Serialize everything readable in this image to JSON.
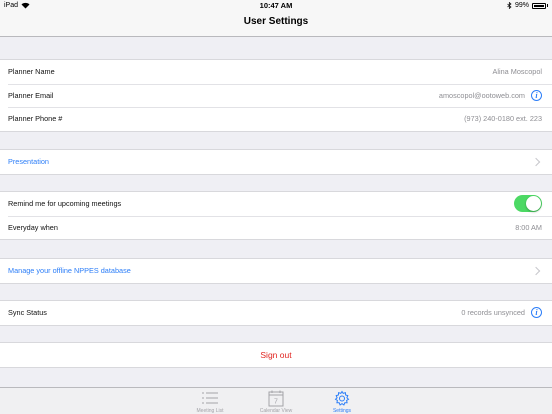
{
  "status_bar": {
    "device": "iPad",
    "time": "10:47 AM",
    "battery": "99%"
  },
  "nav": {
    "title": "User Settings"
  },
  "planner": {
    "name_label": "Planner Name",
    "name_value": "Alina Moscopol",
    "email_label": "Planner Email",
    "email_value": "amoscopol@ootoweb.com",
    "phone_label": "Planner Phone #",
    "phone_value": "(973) 240-0180 ext. 223"
  },
  "presentation": {
    "label": "Presentation"
  },
  "reminder": {
    "label": "Remind me for upcoming meetings",
    "enabled": true,
    "when_label": "Everyday when",
    "when_value": "8:00 AM"
  },
  "offline_db": {
    "label": "Manage your offline NPPES database"
  },
  "sync": {
    "label": "Sync Status",
    "value": "0 records unsynced"
  },
  "signout": {
    "label": "Sign out"
  },
  "tabs": [
    {
      "label": "Meeting List",
      "icon": "list-icon",
      "active": false
    },
    {
      "label": "Calendar View",
      "icon": "calendar-icon",
      "active": false
    },
    {
      "label": "Settings",
      "icon": "gear-icon",
      "active": true
    }
  ],
  "colors": {
    "accent": "#2c7ef8",
    "destructive": "#e0231e",
    "toggle_on": "#4cd964"
  }
}
